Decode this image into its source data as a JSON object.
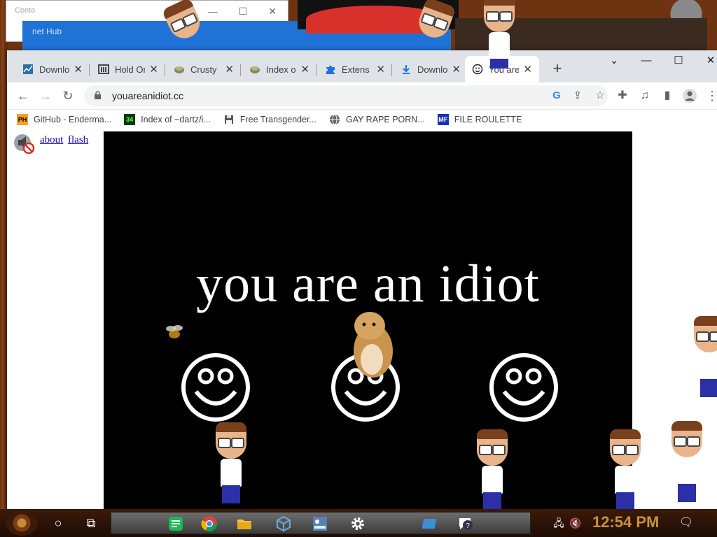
{
  "background_windows": {
    "top_left_title": "Conte",
    "blue_window_title": "net Hub"
  },
  "tabs": [
    {
      "label": "Downlo",
      "icon": "chart-icon"
    },
    {
      "label": "Hold On",
      "icon": "building-icon"
    },
    {
      "label": "Crusty",
      "icon": "bread-icon"
    },
    {
      "label": "Index o",
      "icon": "bread-icon"
    },
    {
      "label": "Extens",
      "icon": "puzzle-icon"
    },
    {
      "label": "Downlo",
      "icon": "download-icon"
    },
    {
      "label": "You are",
      "icon": "smiley-icon",
      "active": true
    }
  ],
  "address_bar": {
    "url": "youareanidiot.cc"
  },
  "bookmarks": [
    {
      "label": "GitHub - Enderma...",
      "icon": "PH"
    },
    {
      "label": "Index of ~dartz/i...",
      "icon": "34"
    },
    {
      "label": "Free Transgender...",
      "icon": "floppy-icon"
    },
    {
      "label": "GAY RAPE PORN...",
      "icon": "globe-icon"
    },
    {
      "label": "FILE ROULETTE",
      "icon": "MF"
    }
  ],
  "page": {
    "links": [
      "about",
      "flash"
    ],
    "heading": "you are an idiot"
  },
  "taskbar": {
    "clock": "12:54 PM"
  }
}
